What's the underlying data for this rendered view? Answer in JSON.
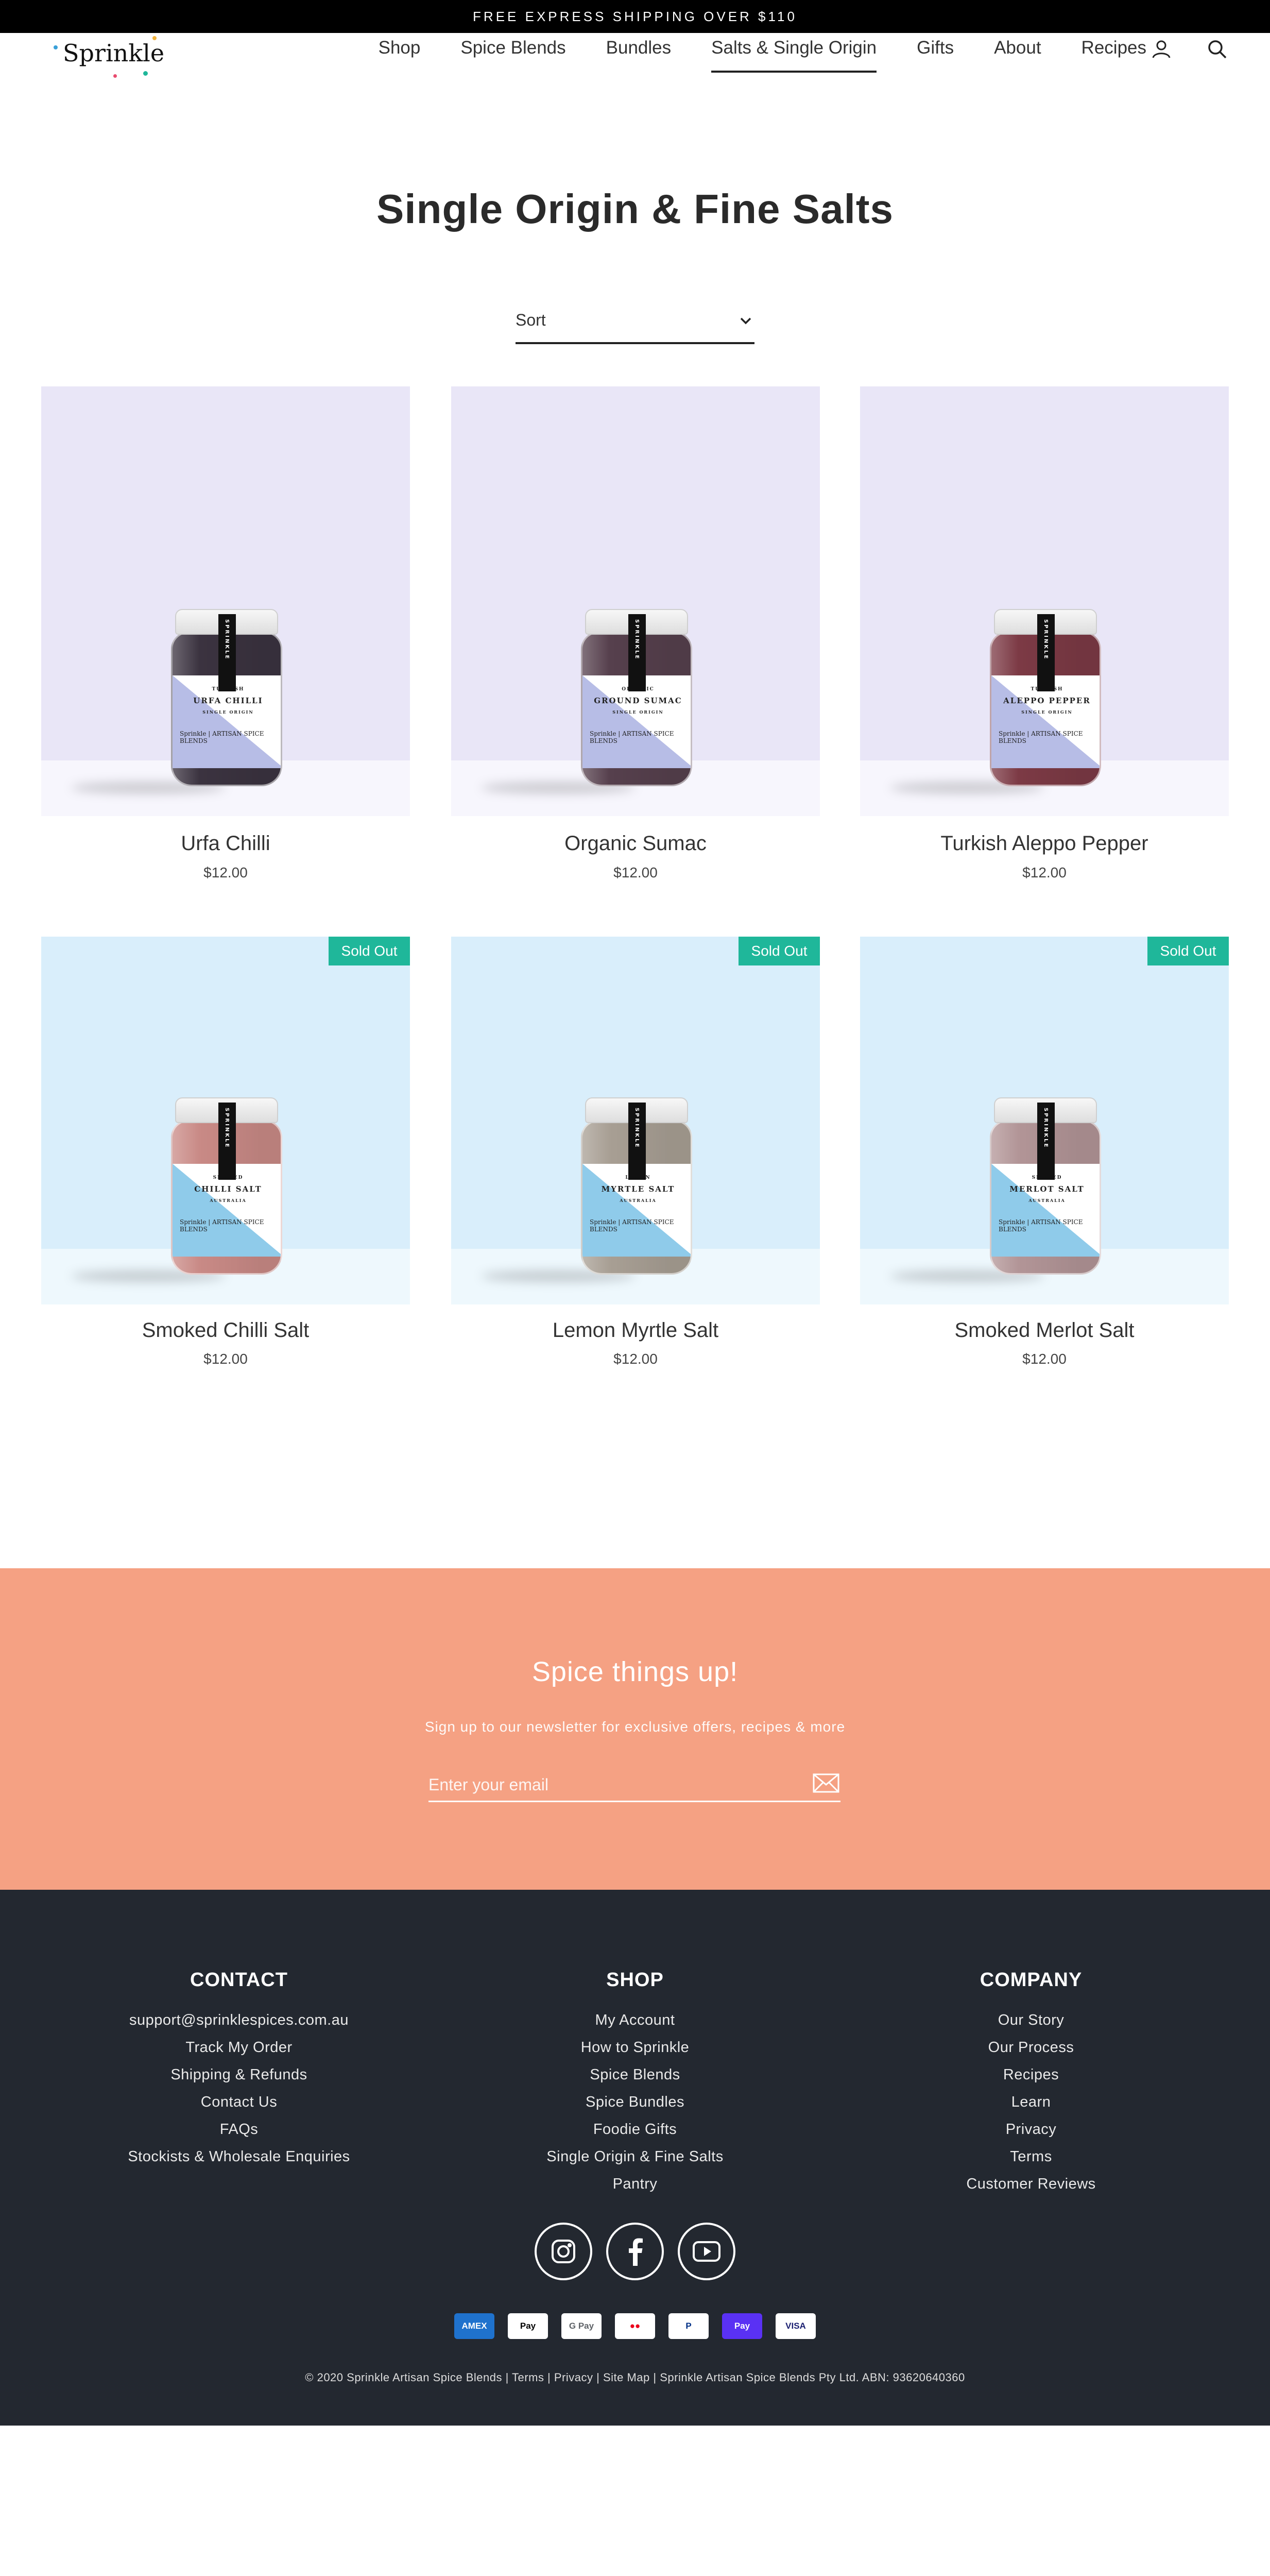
{
  "announcement": "FREE EXPRESS SHIPPING OVER $110",
  "brand": {
    "name": "Sprinkle"
  },
  "nav": {
    "items": [
      {
        "label": "Shop"
      },
      {
        "label": "Spice Blends"
      },
      {
        "label": "Bundles"
      },
      {
        "label": "Salts & Single Origin",
        "active": true
      },
      {
        "label": "Gifts"
      },
      {
        "label": "About"
      },
      {
        "label": "Recipes"
      }
    ],
    "icons": [
      "account-icon",
      "search-icon"
    ]
  },
  "page": {
    "title": "Single Origin & Fine Salts"
  },
  "sort": {
    "label": "Sort"
  },
  "colors": {
    "lavender_bg": "#e9e6f7",
    "sky_bg": "#d9eefb",
    "sold_badge": "#1fb79a",
    "newsletter_bg": "#f5a183",
    "footer_bg": "#232830"
  },
  "products": [
    {
      "name": "Urfa Chilli",
      "price": "$12.00",
      "sold_out": false,
      "jar": {
        "line1": "TURKISH",
        "line2": "URFA CHILLI",
        "line3": "SINGLE ORIGIN",
        "strip": "SPRINKLE",
        "brand": "Sprinkle",
        "tag": "ARTISAN SPICE BLENDS"
      }
    },
    {
      "name": "Organic Sumac",
      "price": "$12.00",
      "sold_out": false,
      "jar": {
        "line1": "ORGANIC",
        "line2": "GROUND SUMAC",
        "line3": "SINGLE ORIGIN",
        "strip": "SPRINKLE",
        "brand": "Sprinkle",
        "tag": "ARTISAN SPICE BLENDS"
      }
    },
    {
      "name": "Turkish Aleppo Pepper",
      "price": "$12.00",
      "sold_out": false,
      "jar": {
        "line1": "TURKISH",
        "line2": "ALEPPO PEPPER",
        "line3": "SINGLE ORIGIN",
        "strip": "SPRINKLE",
        "brand": "Sprinkle",
        "tag": "ARTISAN SPICE BLENDS"
      }
    },
    {
      "name": "Smoked Chilli Salt",
      "price": "$12.00",
      "sold_out": true,
      "badge": "Sold Out",
      "jar": {
        "line1": "SMOKED",
        "line2": "CHILLI SALT",
        "line3": "AUSTRALIA",
        "strip": "SPRINKLE",
        "brand": "Sprinkle",
        "tag": "ARTISAN SPICE BLENDS"
      }
    },
    {
      "name": "Lemon Myrtle Salt",
      "price": "$12.00",
      "sold_out": true,
      "badge": "Sold Out",
      "jar": {
        "line1": "LEMON",
        "line2": "MYRTLE SALT",
        "line3": "AUSTRALIA",
        "strip": "SPRINKLE",
        "brand": "Sprinkle",
        "tag": "ARTISAN SPICE BLENDS"
      }
    },
    {
      "name": "Smoked Merlot Salt",
      "price": "$12.00",
      "sold_out": true,
      "badge": "Sold Out",
      "jar": {
        "line1": "SMOKED",
        "line2": "MERLOT SALT",
        "line3": "AUSTRALIA",
        "strip": "SPRINKLE",
        "brand": "Sprinkle",
        "tag": "ARTISAN SPICE BLENDS"
      }
    }
  ],
  "newsletter": {
    "title": "Spice things up!",
    "subtitle": "Sign up to our newsletter for exclusive offers, recipes & more",
    "placeholder": "Enter your email"
  },
  "footer": {
    "contact": {
      "heading": "CONTACT",
      "links": [
        "support@sprinklespices.com.au",
        "Track My Order",
        "Shipping & Refunds",
        "Contact Us",
        "FAQs",
        "Stockists & Wholesale Enquiries"
      ]
    },
    "shop": {
      "heading": "SHOP",
      "links": [
        "My Account",
        "How to Sprinkle",
        "Spice Blends",
        "Spice Bundles",
        "Foodie Gifts",
        "Single Origin & Fine Salts",
        "Pantry"
      ]
    },
    "company": {
      "heading": "COMPANY",
      "links": [
        "Our Story",
        "Our Process",
        "Recipes",
        "Learn",
        "Privacy",
        "Terms",
        "Customer Reviews"
      ]
    },
    "socials": [
      "instagram-icon",
      "facebook-icon",
      "youtube-icon"
    ],
    "payments": [
      {
        "label": "AMEX",
        "bg": "#1f72cd",
        "fg": "#ffffff"
      },
      {
        "label": "Pay",
        "bg": "#ffffff",
        "fg": "#000000"
      },
      {
        "label": "G Pay",
        "bg": "#ffffff",
        "fg": "#5f6368"
      },
      {
        "label": "●●",
        "bg": "#ffffff",
        "fg": "#eb001b"
      },
      {
        "label": "P",
        "bg": "#ffffff",
        "fg": "#003087"
      },
      {
        "label": "Pay",
        "bg": "#5a31f4",
        "fg": "#ffffff"
      },
      {
        "label": "VISA",
        "bg": "#ffffff",
        "fg": "#1a1f71"
      }
    ],
    "copyright": "© 2020 Sprinkle Artisan Spice Blends | Terms | Privacy | Site Map | Sprinkle Artisan Spice Blends Pty Ltd. ABN: 93620640360"
  }
}
